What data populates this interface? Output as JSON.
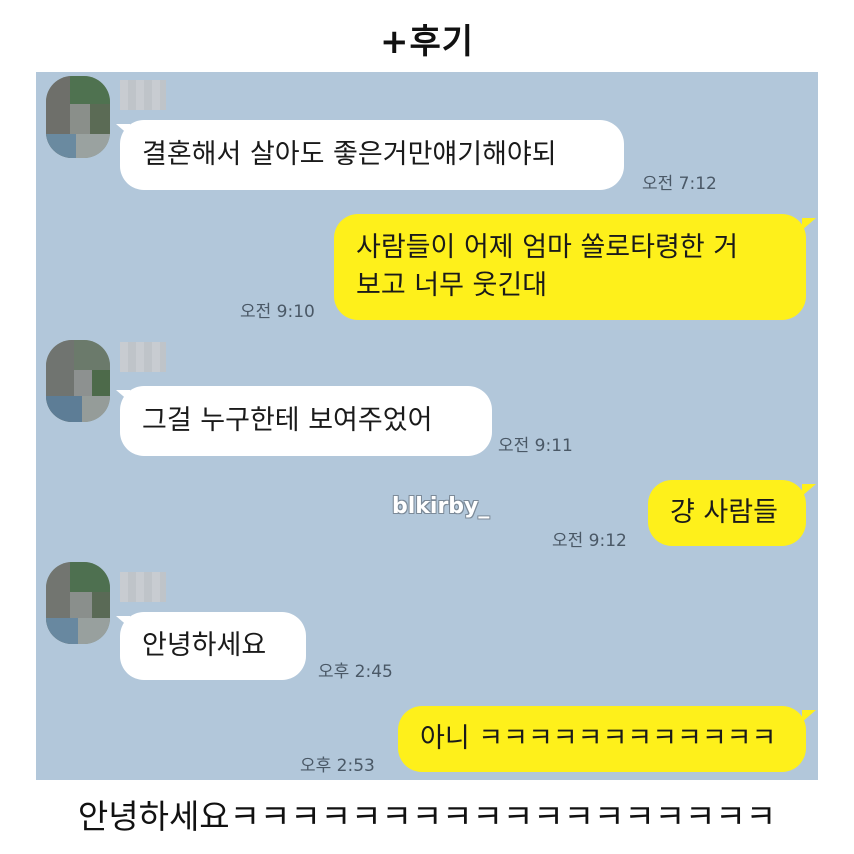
{
  "page_title": "+후기",
  "watermark": "blkirby_",
  "caption": "안녕하세요ㅋㅋㅋㅋㅋㅋㅋㅋㅋㅋㅋㅋㅋㅋㅋㅋㅋㅋ",
  "colors": {
    "chat_background": "#b2c7da",
    "incoming_bubble": "#ffffff",
    "outgoing_bubble": "#fef01b"
  },
  "messages": [
    {
      "direction": "incoming",
      "text": "결혼해서 살아도  좋은거만얘기해야되",
      "time": "오전 7:12"
    },
    {
      "direction": "outgoing",
      "lines": [
        "사람들이 어제 엄마 쏠로타령한 거",
        "보고 너무 웃긴대"
      ],
      "time": "오전 9:10"
    },
    {
      "direction": "incoming",
      "text": "그걸 누구한테 보여주었어",
      "time": "오전 9:11"
    },
    {
      "direction": "outgoing",
      "text": "걍 사람들",
      "time": "오전 9:12"
    },
    {
      "direction": "incoming",
      "text": "안녕하세요",
      "time": "오후 2:45"
    },
    {
      "direction": "outgoing",
      "text": "아니 ㅋㅋㅋㅋㅋㅋㅋㅋㅋㅋㅋㅋ",
      "time": "오후 2:53"
    }
  ]
}
